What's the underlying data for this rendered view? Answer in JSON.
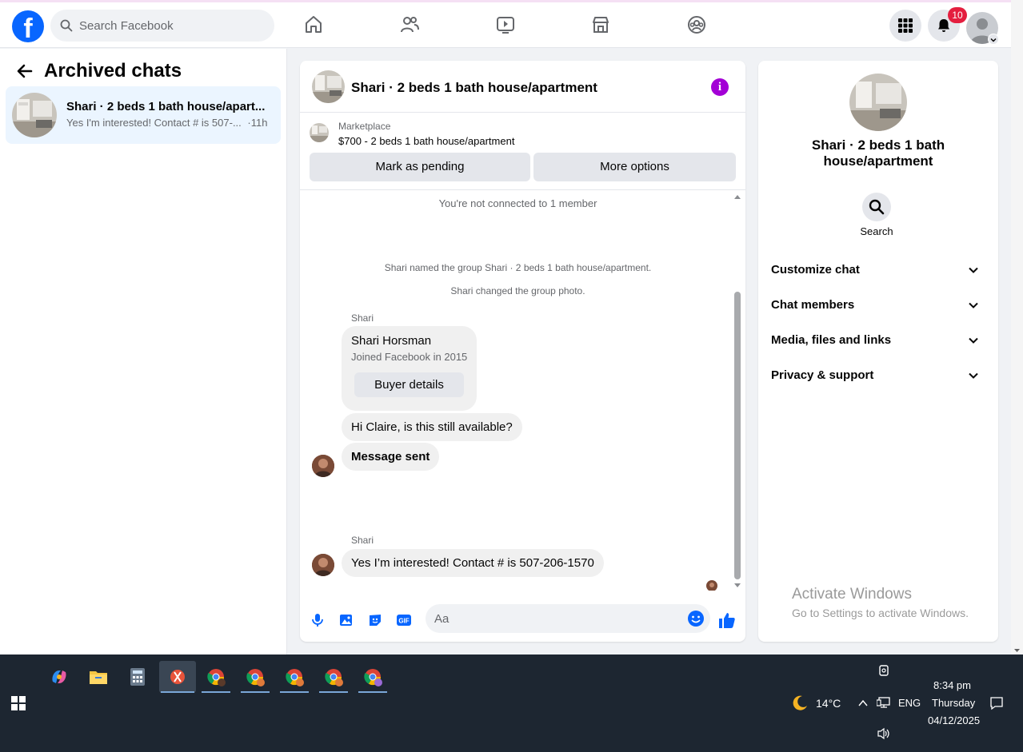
{
  "topbar": {
    "logo": "f",
    "search_placeholder": "Search Facebook",
    "notifications_count": "10",
    "nav_icons": [
      "home-icon",
      "friends-icon",
      "watch-icon",
      "marketplace-icon",
      "groups-icon"
    ]
  },
  "left": {
    "title": "Archived chats",
    "chats": [
      {
        "title": "Shari · 2 beds 1 bath house/apart...",
        "preview": "Yes I'm interested! Contact # is 507-...",
        "time": "·11h"
      }
    ]
  },
  "chat": {
    "title": "Shari · 2 beds 1 bath house/apartment",
    "marketplace_label": "Marketplace",
    "listing": "$700 - 2 beds 1 bath house/apartment",
    "mark_pending": "Mark as pending",
    "more_options": "More options",
    "not_connected": "You're not connected to 1 member",
    "sys_named": "Shari named the group Shari · 2 beds 1 bath house/apartment.",
    "sys_photo": "Shari changed the group photo.",
    "sender1": "Shari",
    "card_name": "Shari Horsman",
    "card_joined": "Joined Facebook in 2015",
    "buyer_details": "Buyer details",
    "msg1": "Hi Claire, is this still available?",
    "msg2": "Message sent",
    "sender2": "Shari",
    "msg3": "Yes I’m interested!  Contact # is 507-206-1570",
    "input_placeholder": "Aa"
  },
  "info": {
    "title": "Shari · 2 beds 1 bath house/apartment",
    "search_label": "Search",
    "sections": [
      "Customize chat",
      "Chat members",
      "Media, files and links",
      "Privacy & support"
    ]
  },
  "watermark": {
    "line1": "Activate Windows",
    "line2": "Go to Settings to activate Windows."
  },
  "taskbar": {
    "weather": "14°C",
    "lang": "ENG",
    "time": "8:34 pm",
    "day": "Thursday",
    "date": "04/12/2025"
  },
  "colors": {
    "brand": "#0866ff",
    "badge": "#e41e3f",
    "info": "#a300d6",
    "selected_chat": "#ebf5ff"
  }
}
